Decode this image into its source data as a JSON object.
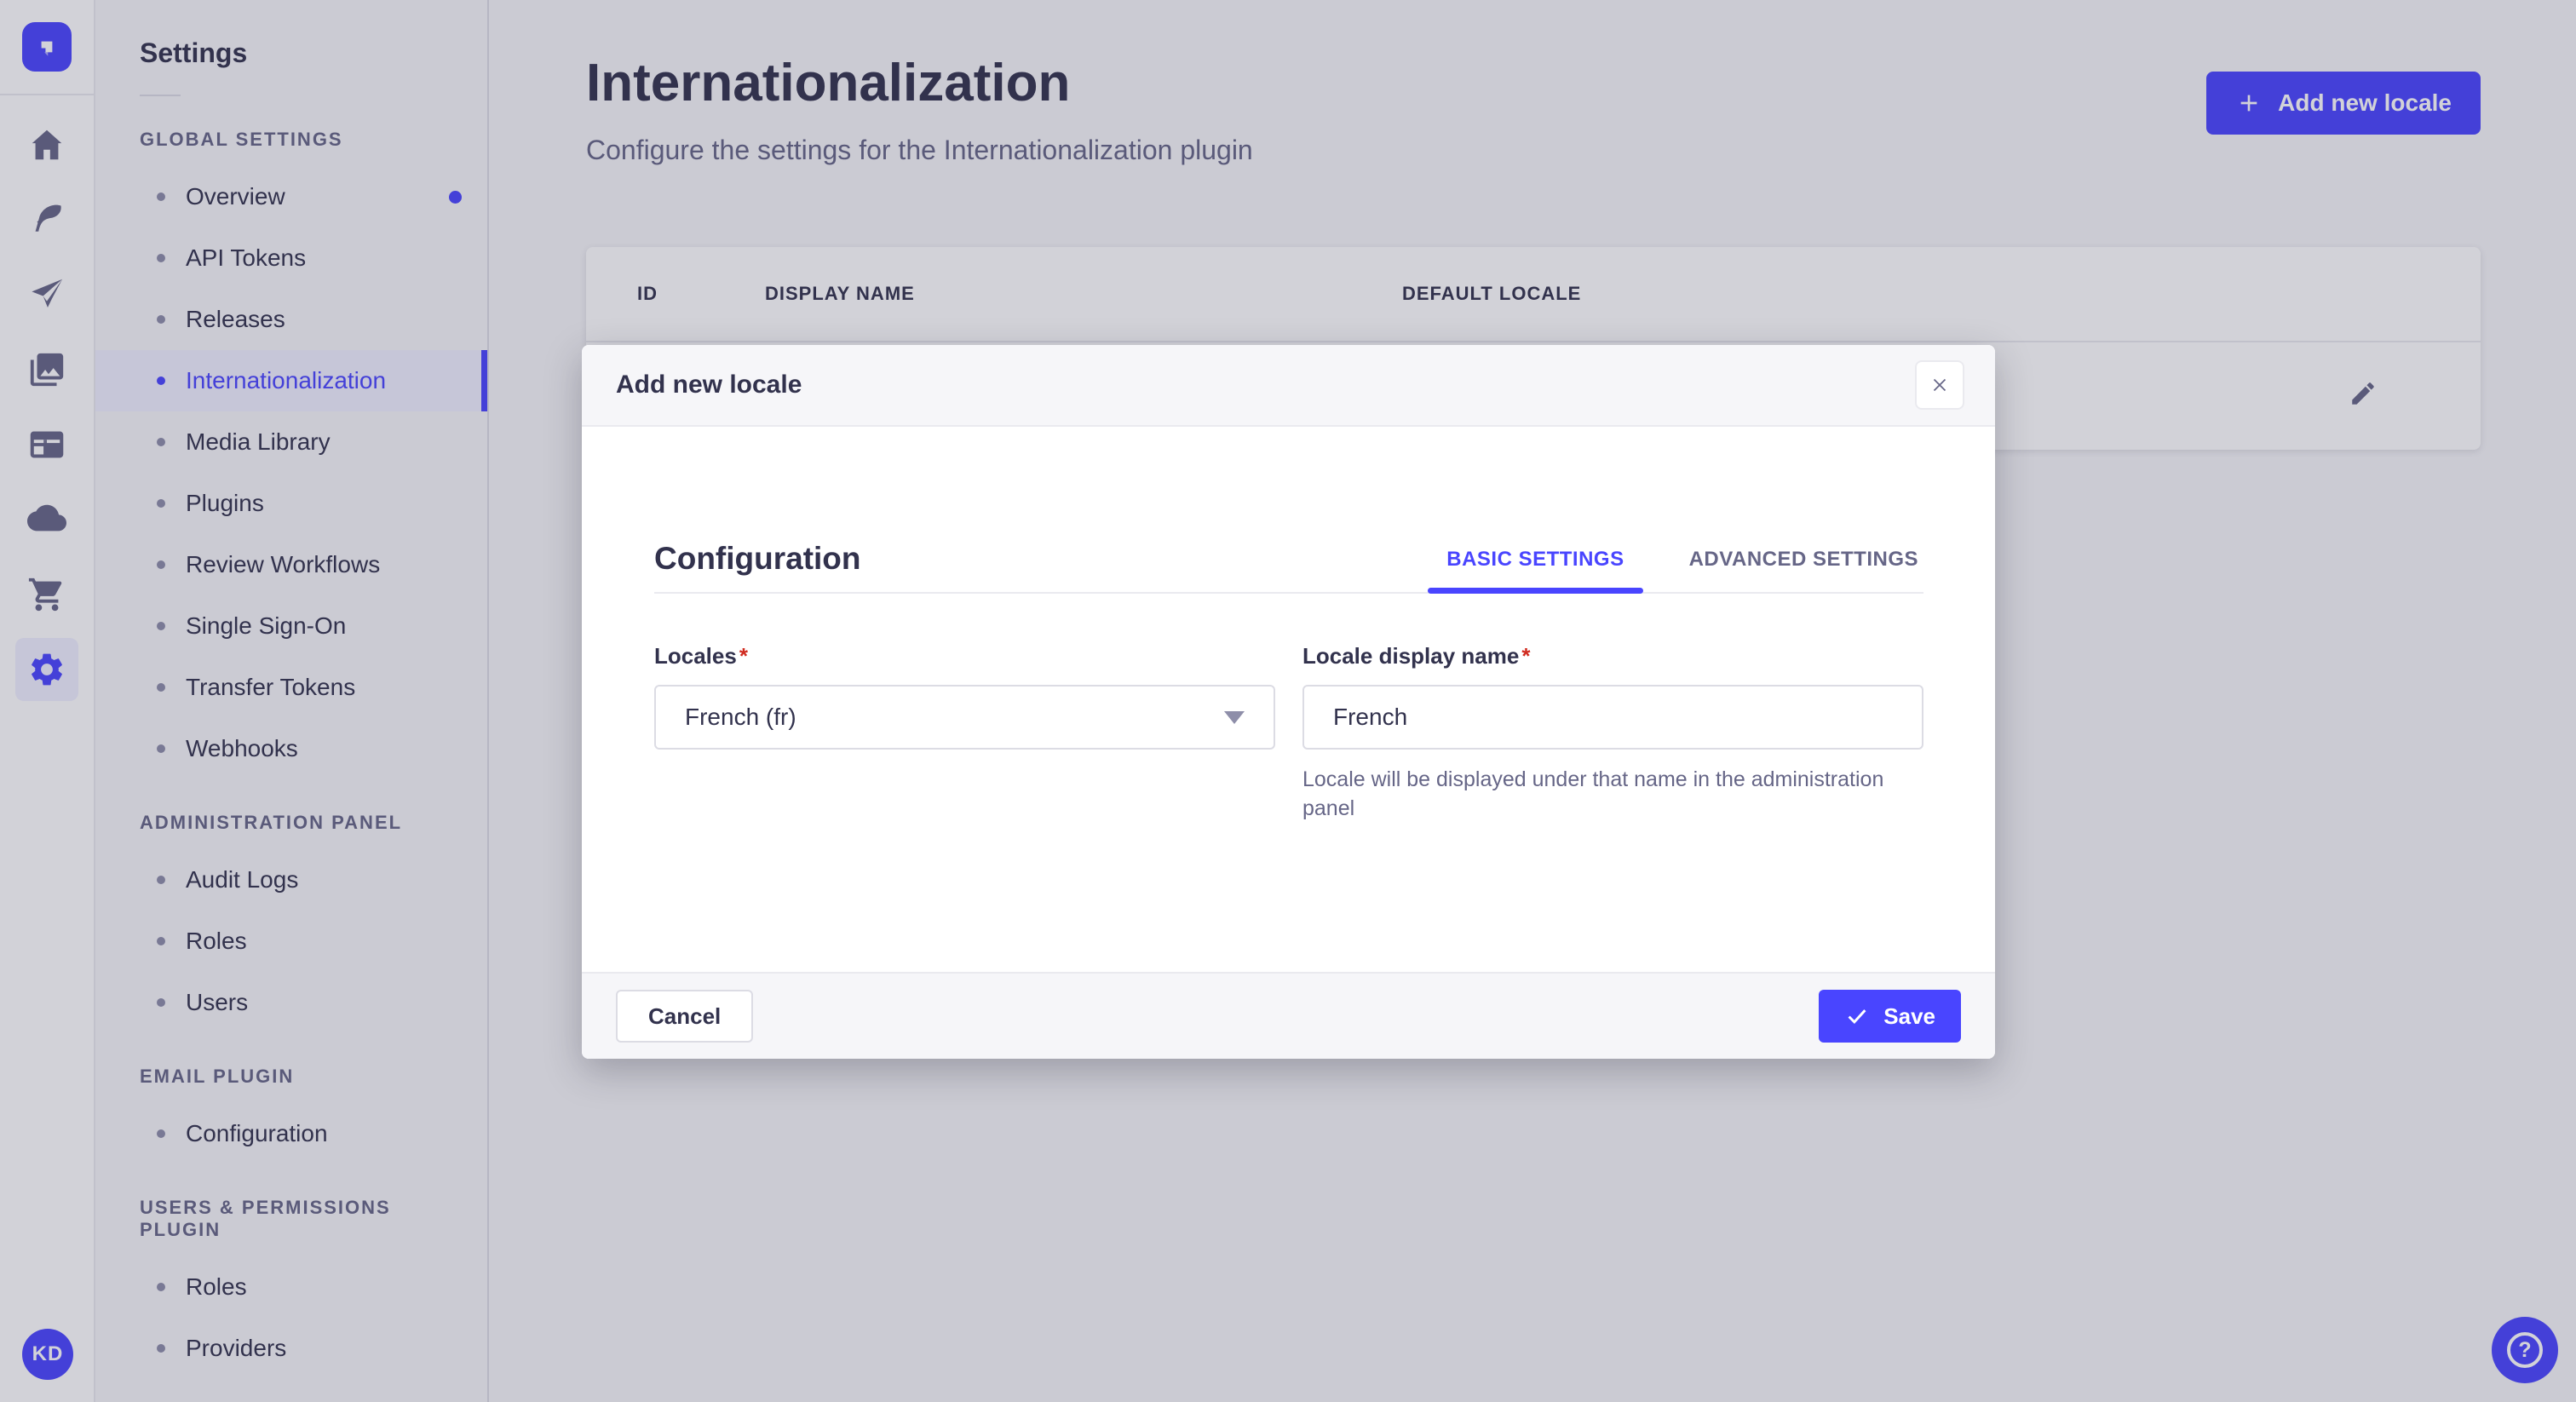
{
  "colors": {
    "accent": "#4945FF",
    "text_dark": "#32324D",
    "text_muted": "#666687",
    "border": "#DCDCE4",
    "active_bg": "#F0F0FF",
    "required": "#D02B20"
  },
  "ui": {
    "required_marker": "*"
  },
  "icon_rail": {
    "icons": [
      "strapi-logo",
      "home",
      "feather",
      "paper-plane",
      "media-library",
      "layout",
      "cloud",
      "cart",
      "settings-gear"
    ],
    "active_icon": "settings-gear"
  },
  "user": {
    "initials": "KD"
  },
  "sidebar": {
    "title": "Settings",
    "sections": [
      {
        "label": "GLOBAL SETTINGS",
        "items": [
          {
            "label": "Overview",
            "has_notification": true
          },
          {
            "label": "API Tokens"
          },
          {
            "label": "Releases"
          },
          {
            "label": "Internationalization",
            "active": true
          },
          {
            "label": "Media Library"
          },
          {
            "label": "Plugins"
          },
          {
            "label": "Review Workflows"
          },
          {
            "label": "Single Sign-On"
          },
          {
            "label": "Transfer Tokens"
          },
          {
            "label": "Webhooks"
          }
        ]
      },
      {
        "label": "ADMINISTRATION PANEL",
        "items": [
          {
            "label": "Audit Logs"
          },
          {
            "label": "Roles"
          },
          {
            "label": "Users"
          }
        ]
      },
      {
        "label": "EMAIL PLUGIN",
        "items": [
          {
            "label": "Configuration"
          }
        ]
      },
      {
        "label": "USERS & PERMISSIONS PLUGIN",
        "items": [
          {
            "label": "Roles"
          },
          {
            "label": "Providers"
          }
        ]
      }
    ]
  },
  "header": {
    "title": "Internationalization",
    "subtitle": "Configure the settings for the Internationalization plugin",
    "add_button_label": "Add new locale"
  },
  "table": {
    "columns": [
      "ID",
      "DISPLAY NAME",
      "DEFAULT LOCALE"
    ]
  },
  "modal": {
    "title": "Add new locale",
    "section_title": "Configuration",
    "tabs": [
      {
        "label": "BASIC SETTINGS",
        "active": true
      },
      {
        "label": "ADVANCED SETTINGS",
        "active": false
      }
    ],
    "fields": {
      "locales": {
        "label": "Locales",
        "value": "French (fr)"
      },
      "display_name": {
        "label": "Locale display name",
        "value": "French",
        "hint": "Locale will be displayed under that name in the administration panel"
      }
    },
    "cancel_label": "Cancel",
    "save_label": "Save"
  },
  "help": {
    "glyph": "?"
  }
}
